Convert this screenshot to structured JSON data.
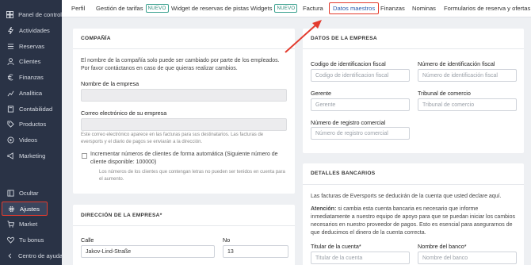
{
  "sidebar": {
    "items": [
      {
        "label": "Panel de control",
        "icon": "dashboard-icon"
      },
      {
        "label": "Actividades",
        "icon": "bolt-icon"
      },
      {
        "label": "Reservas",
        "icon": "list-icon"
      },
      {
        "label": "Clientes",
        "icon": "user-icon"
      },
      {
        "label": "Finanzas",
        "icon": "euro-icon"
      },
      {
        "label": "Analítica",
        "icon": "analytics-icon"
      },
      {
        "label": "Contabilidad",
        "icon": "book-icon"
      },
      {
        "label": "Productos",
        "icon": "tag-icon"
      },
      {
        "label": "Videos",
        "icon": "play-icon"
      },
      {
        "label": "Marketing",
        "icon": "megaphone-icon"
      },
      {
        "label": "Ocultar",
        "icon": "hide-icon"
      },
      {
        "label": "Ajustes",
        "icon": "gear-icon"
      },
      {
        "label": "Market",
        "icon": "cart-icon"
      },
      {
        "label": "Tu bonus",
        "icon": "heart-icon"
      },
      {
        "label": "Centro de ayuda",
        "icon": "chevron-icon"
      }
    ],
    "active": "Ajustes"
  },
  "topnav": {
    "tabs": [
      "Perfil",
      "Gestión de tarifas",
      "Widget de reservas de pistas",
      "Widgets",
      "Factura",
      "Datos maestros",
      "Finanzas",
      "Nominas",
      "Formularios de reserva y ofertas"
    ],
    "badge": "NUEVO",
    "active": "Datos maestros"
  },
  "company": {
    "title": "COMPAÑÍA",
    "notice": "El nombre de la compañía solo puede ser cambiado por parte de los empleados. Por favor contáctanos en caso de que quieras realizar cambios.",
    "name_label": "Nombre de la empresa",
    "name_value": "",
    "email_label": "Correo electrónico de su empresa",
    "email_value": "",
    "email_help": "Este correo electrónico aparece en las facturas para sus destinatarios. Las facturas de eversports y el diario de pagos se enviarán a la dirección.",
    "checkbox_label": "Incrementar números de clientes de forma automática (Siguiente número de cliente disponible: 100000)",
    "checkbox_help": "Los números de los clientes que contengan letras no pueden ser tenidos en cuenta para el aumento."
  },
  "address": {
    "title": "DIRECCIÓN DE LA EMPRESA*",
    "street_label": "Calle",
    "street_value": "Jakov-Lind-Straße",
    "number_label": "No",
    "number_value": "13"
  },
  "company_data": {
    "title": "DATOS DE LA EMPRESA",
    "fiscal_code_label": "Codigo de identificacion fiscal",
    "fiscal_code_placeholder": "Codigo de identificacion fiscal",
    "fiscal_number_label": "Número de identificación fiscal",
    "fiscal_number_placeholder": "Número de identificación fiscal",
    "manager_label": "Gerente",
    "manager_placeholder": "Gerente",
    "registry_court_label": "Tribunal de comercio",
    "registry_court_placeholder": "Tribunal de comercio",
    "registry_number_label": "Número de registro comercial",
    "registry_number_placeholder": "Número de registro comercial"
  },
  "bank": {
    "title": "DETALLES BANCARIOS",
    "intro": "Las facturas de Eversports se deducirán de la cuenta que usted declare aquí.",
    "attention_label": "Atención:",
    "attention_text": " si cambia esta cuenta bancaria es necesario que informe inmediatamente a nuestro equipo de apoyo para que se puedan iniciar los cambios necesarios en nuestro proveedor de pagos. Esto es esencial para asegurarnos de que deducimos el dinero de la cuenta correcta.",
    "holder_label": "Titular de la cuenta*",
    "holder_placeholder": "Titular de la cuenta",
    "bank_label": "Nombre del banco*",
    "bank_placeholder": "Nombre del banco"
  },
  "colors": {
    "sidebar": "#2a3346",
    "highlight": "#e33b2e",
    "badge": "#3aa18f"
  }
}
